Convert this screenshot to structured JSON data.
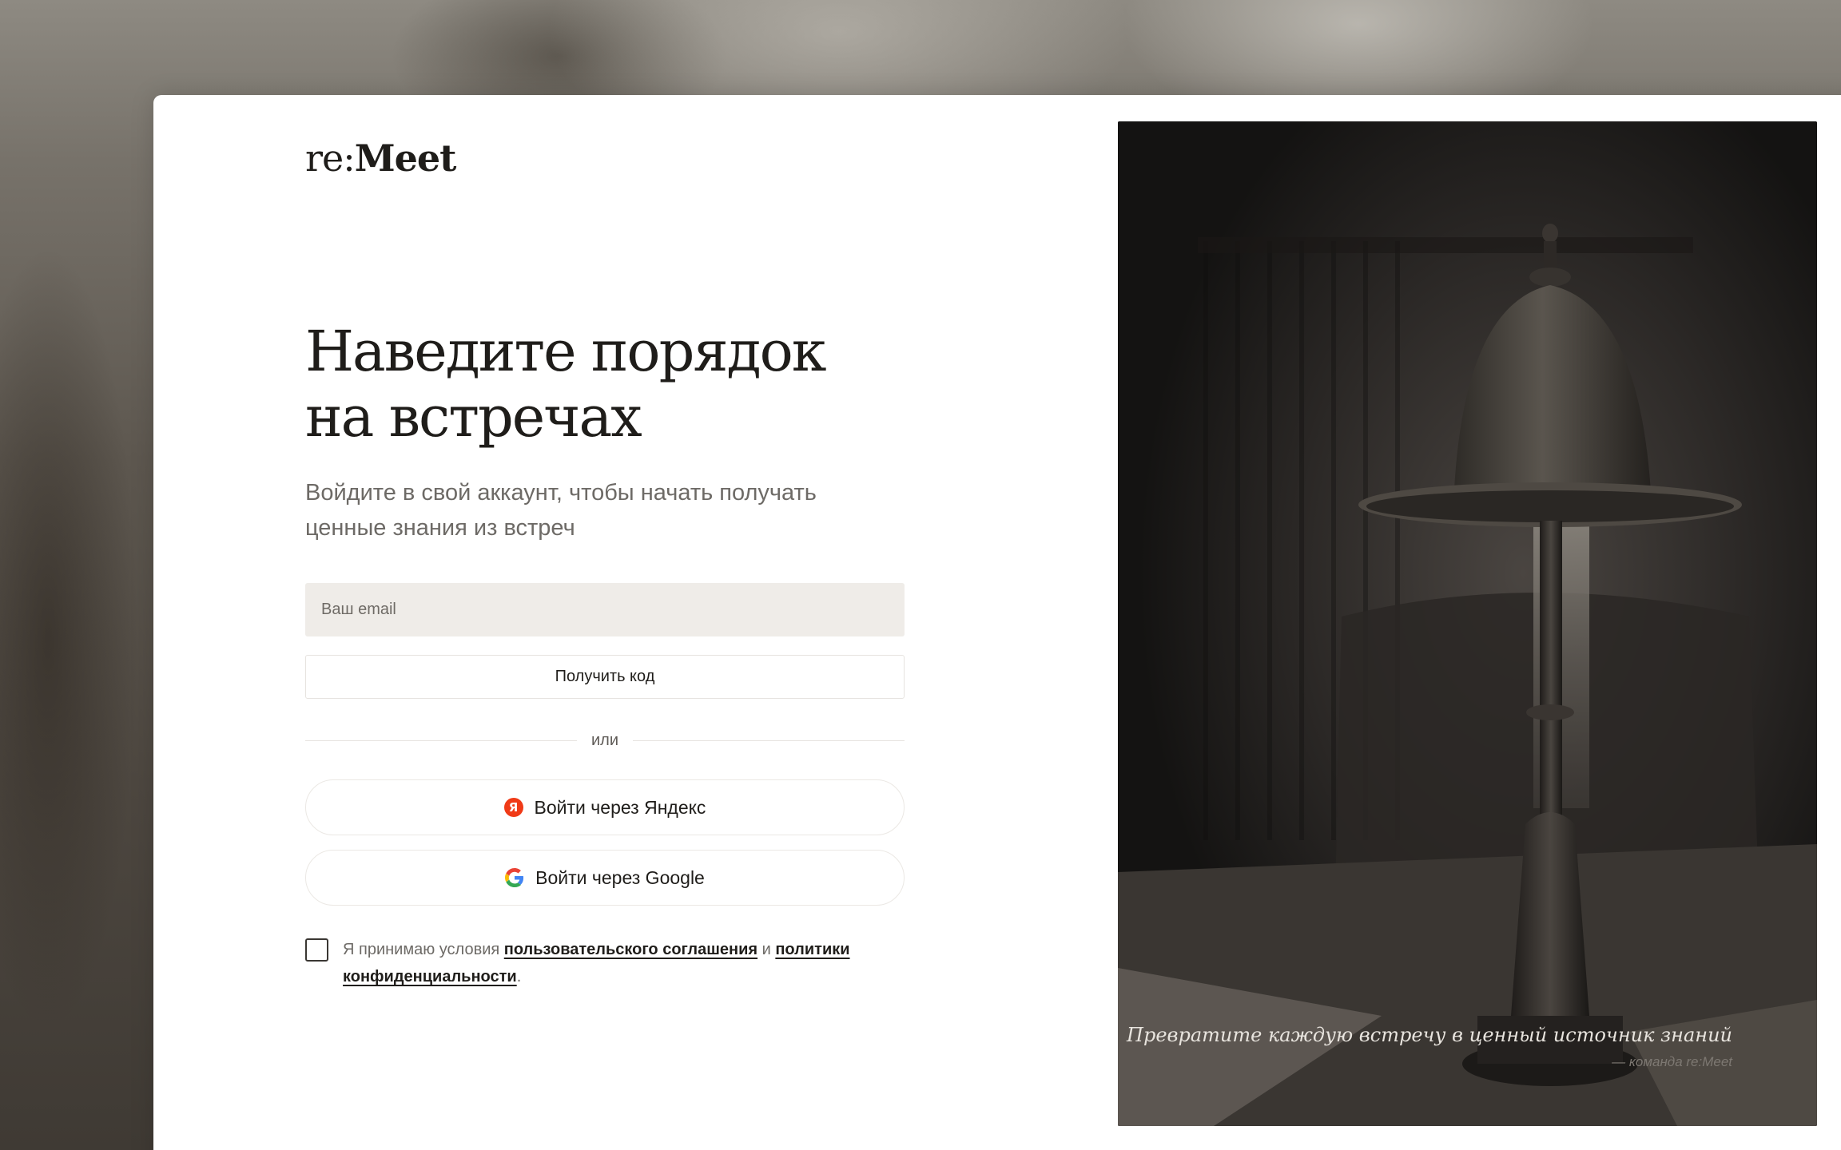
{
  "app": {
    "logo_prefix": "re:",
    "logo_name": "Meet"
  },
  "hero": {
    "headline_line1": "Наведите порядок",
    "headline_line2": "на встречах",
    "subtitle_line1": "Войдите в свой аккаунт, чтобы начать получать",
    "subtitle_line2": "ценные знания из встреч"
  },
  "form": {
    "email_placeholder": "Ваш email",
    "email_value": "",
    "get_code_label": "Получить код",
    "divider_text": "или",
    "yandex_label": "Войти через Яндекс",
    "yandex_icon_letter": "Я",
    "google_label": "Войти через Google"
  },
  "consent": {
    "checked": false,
    "text_before": "Я принимаю условия ",
    "terms_link": "пользовательского соглашения",
    "text_middle": " и ",
    "privacy_link_part1": "политики",
    "privacy_link_part2": "конфиденциальности",
    "text_end": "."
  },
  "photo": {
    "quote": "Превратите каждую встречу в ценный источник знаний",
    "quote_author": "— команда re:Meet"
  },
  "icons": {
    "yandex": "yandex-logo-icon",
    "google": "google-logo-icon"
  },
  "colors": {
    "accent_text": "#1f1d1a",
    "input_background": "#efece8",
    "yandex_red": "#f03a17"
  }
}
